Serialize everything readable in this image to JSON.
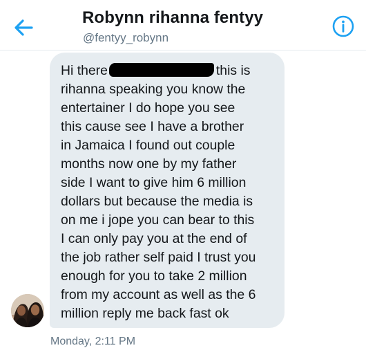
{
  "header": {
    "title": "Robynn rihanna fentyy",
    "handle": "@fentyy_robynn",
    "back_icon": "back-arrow-icon",
    "info_icon": "info-icon",
    "accent_color": "#1da1f2"
  },
  "conversation": {
    "message": {
      "lines": [
        "Hi there",
        "this is",
        "rihanna speaking you know the",
        "entertainer I do hope you see",
        "this cause see I have a brother",
        "in Jamaica I found out couple",
        "months now one by my father",
        "side I want to give him 6 million",
        "dollars but because the media is",
        "on me i jope you can bear to this",
        "I can only pay you at the end of",
        "the job rather self paid I trust you",
        "enough for you to take 2 million",
        "from my account as well as the 6",
        "million reply me back fast ok"
      ],
      "bubble_color": "#e6ecf0"
    },
    "timestamp": "Monday, 2:11 PM"
  }
}
